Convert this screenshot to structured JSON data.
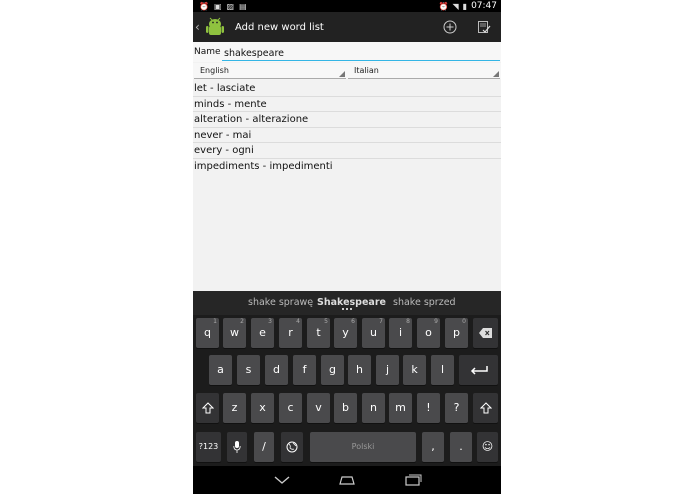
{
  "status_bar": {
    "time": "07:47"
  },
  "action_bar": {
    "title": "Add new word list"
  },
  "form": {
    "name_label": "Name",
    "name_value": "shakespeare",
    "source_language": "English",
    "target_language": "Italian"
  },
  "words": [
    {
      "text": "let - lasciate"
    },
    {
      "text": "minds - mente"
    },
    {
      "text": "alteration - alterazione"
    },
    {
      "text": "never - mai"
    },
    {
      "text": "every - ogni"
    },
    {
      "text": "impediments - impedimenti"
    }
  ],
  "keyboard": {
    "suggestions": [
      "shake sprawę",
      "Shakespeare",
      "shake sprzed"
    ],
    "row1": [
      {
        "k": "q",
        "s": "1"
      },
      {
        "k": "w",
        "s": "2"
      },
      {
        "k": "e",
        "s": "3"
      },
      {
        "k": "r",
        "s": "4"
      },
      {
        "k": "t",
        "s": "5"
      },
      {
        "k": "y",
        "s": "6"
      },
      {
        "k": "u",
        "s": "7"
      },
      {
        "k": "i",
        "s": "8"
      },
      {
        "k": "o",
        "s": "9"
      },
      {
        "k": "p",
        "s": "0"
      }
    ],
    "row2": [
      "a",
      "s",
      "d",
      "f",
      "g",
      "h",
      "j",
      "k",
      "l"
    ],
    "row3": [
      "z",
      "x",
      "c",
      "v",
      "b",
      "n",
      "m",
      "!",
      "?"
    ],
    "symbols_key": "?123",
    "slash_key": "/",
    "space_label": "Polski",
    "comma_key": ",",
    "period_key": ".",
    "emoji_key": "☺"
  },
  "colors": {
    "accent": "#33b5e5",
    "keyboard_bg": "#1c1c1c",
    "key_bg": "#4a4a4c",
    "action_bar": "#222222"
  }
}
